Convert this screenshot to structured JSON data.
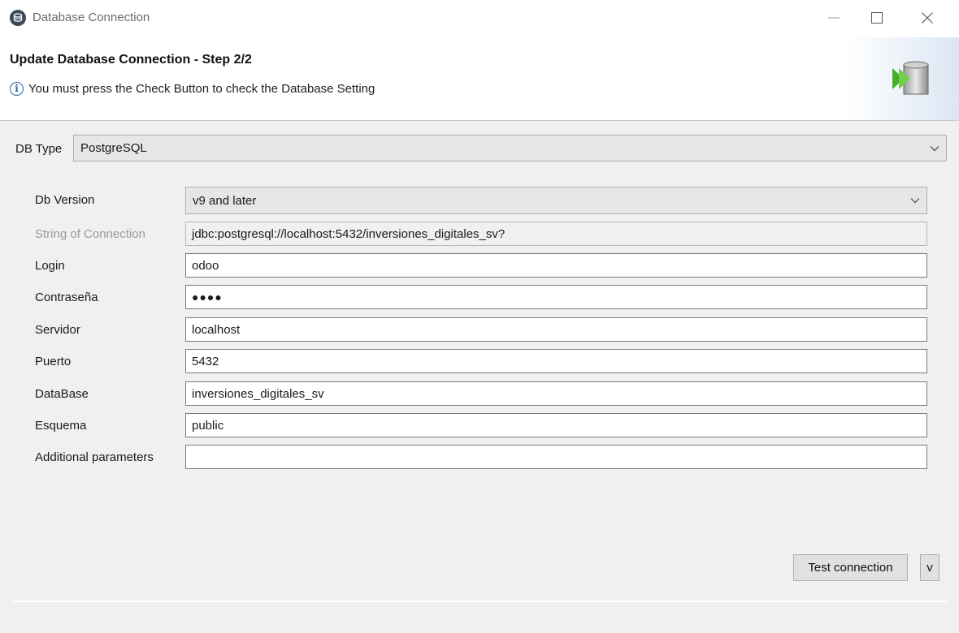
{
  "window": {
    "title": "Database Connection"
  },
  "header": {
    "title_bold": "Update Database Connection",
    "title_rest": " - Step 2/2",
    "info": "You must press the Check Button to check the Database Setting"
  },
  "db_type": {
    "label": "DB Type",
    "value": "PostgreSQL"
  },
  "form": {
    "db_version": {
      "label": "Db Version",
      "value": "v9 and later"
    },
    "connection_string": {
      "label": "String of Connection",
      "value": "jdbc:postgresql://localhost:5432/inversiones_digitales_sv?"
    },
    "login": {
      "label": "Login",
      "value": "odoo"
    },
    "password": {
      "label": "Contraseña",
      "value": "●●●●"
    },
    "server": {
      "label": "Servidor",
      "value": "localhost"
    },
    "port": {
      "label": "Puerto",
      "value": "5432"
    },
    "database": {
      "label": "DataBase",
      "value": "inversiones_digitales_sv"
    },
    "schema": {
      "label": "Esquema",
      "value": "public"
    },
    "additional": {
      "label": "Additional parameters",
      "value": ""
    }
  },
  "buttons": {
    "test_connection": "Test connection",
    "v": "v"
  },
  "colors": {
    "accent_blue": "#2766b0",
    "arrow_green": "#43b02a"
  },
  "icons": [
    "app-icon",
    "info-icon",
    "database-wizard-icon",
    "chevron-down-icon",
    "minimize-icon",
    "maximize-icon",
    "close-icon"
  ]
}
